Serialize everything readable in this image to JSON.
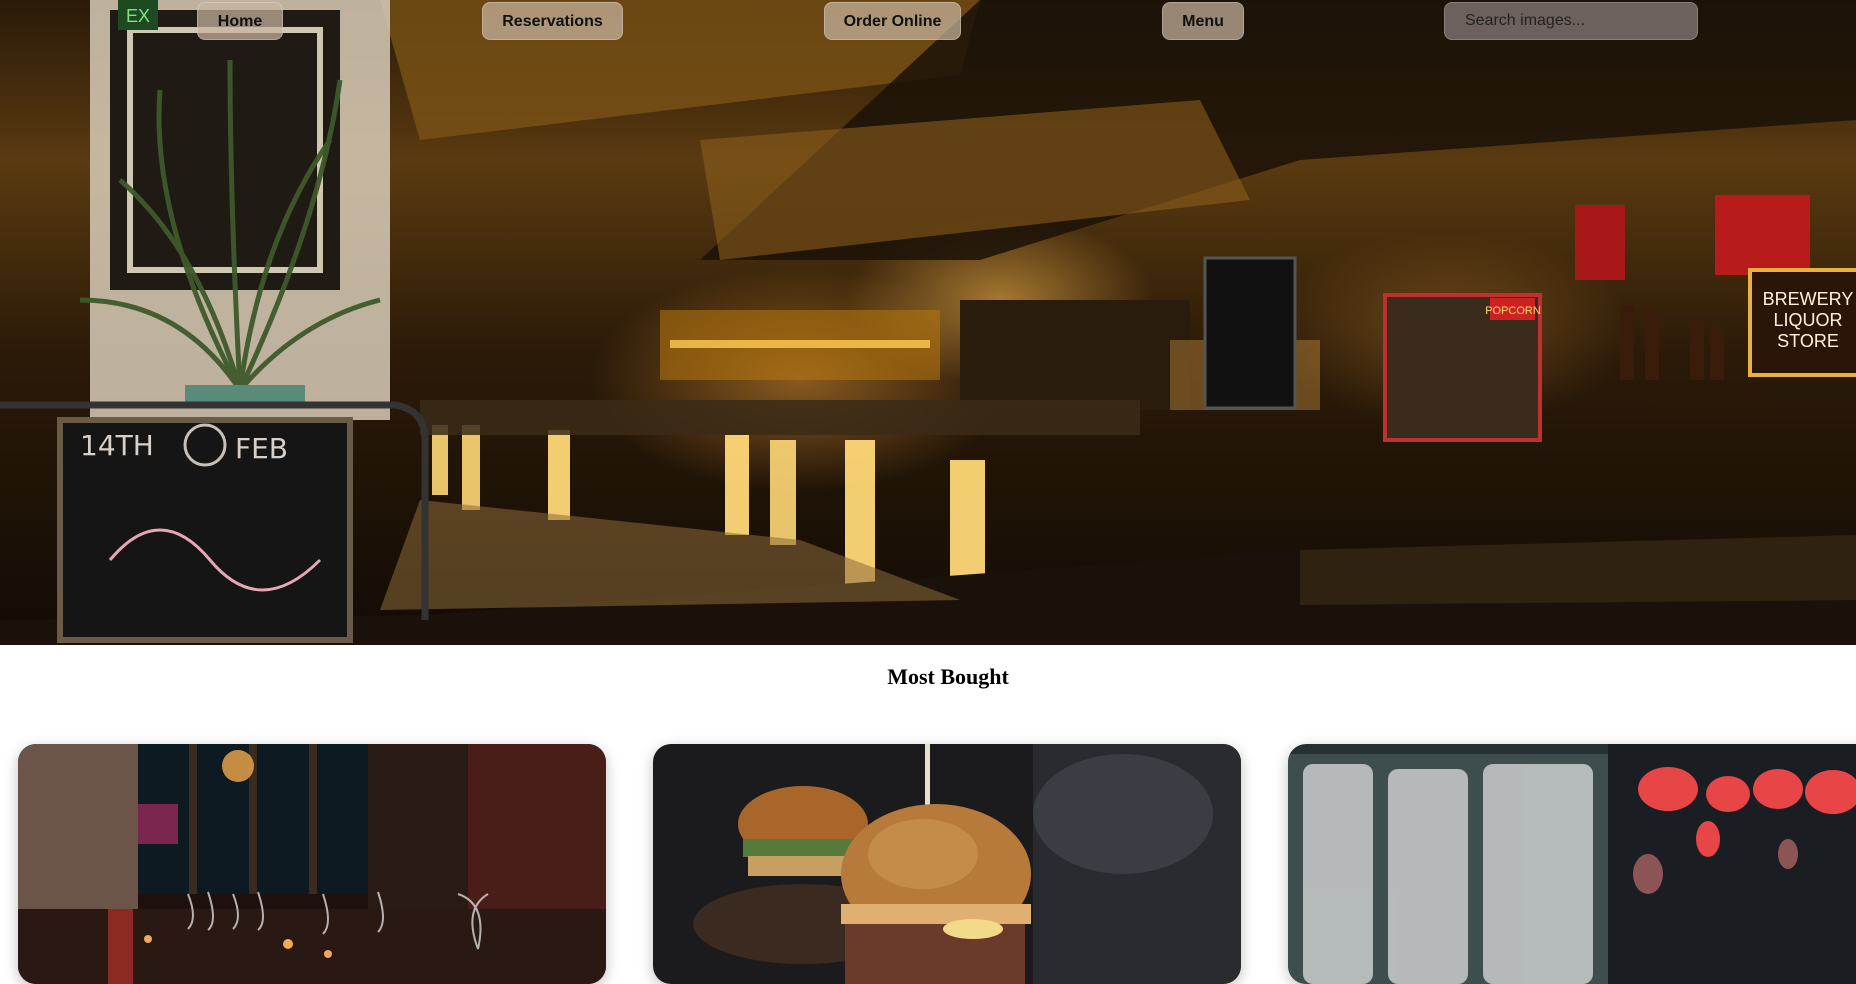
{
  "nav": {
    "home_label": "Home",
    "reservations_label": "Reservations",
    "order_online_label": "Order Online",
    "menu_label": "Menu",
    "search_placeholder": "Search images..."
  },
  "hero": {
    "image": "restaurant-bar-interior",
    "signs": {
      "exit": "EX",
      "brewery_line1": "BREWERY",
      "brewery_line2": "LIQUOR",
      "brewery_line3": "STORE",
      "popcorn": "POPCORN",
      "chalk_date": "14TH",
      "chalk_month": "FEB"
    }
  },
  "most_bought": {
    "title": "Most Bought",
    "cards": [
      {
        "image": "dining-room-wine-glasses"
      },
      {
        "image": "burger"
      },
      {
        "image": "neon-bokeh"
      }
    ]
  }
}
